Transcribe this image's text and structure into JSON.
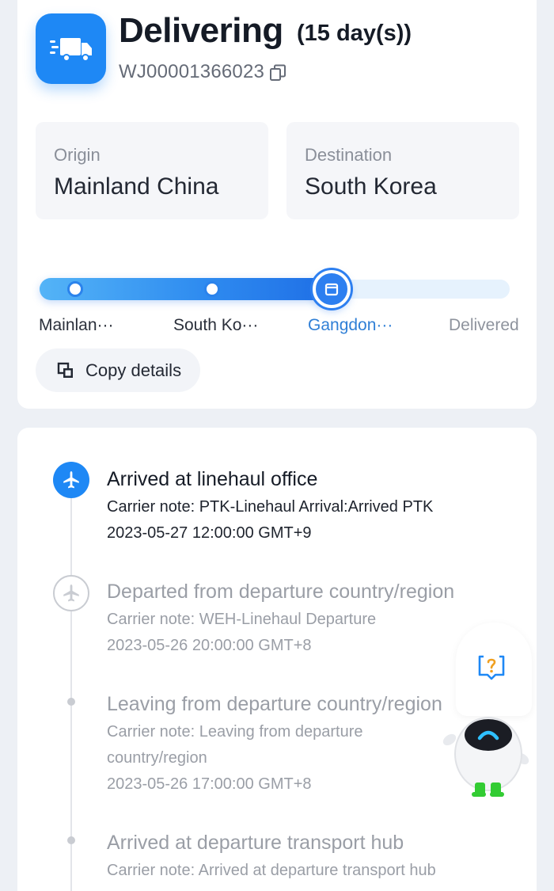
{
  "header": {
    "status": "Delivering",
    "duration": "(15 day(s))",
    "tracking_number": "WJ00001366023",
    "status_icon": "truck-icon",
    "copy_icon": "copy-icon"
  },
  "route": {
    "origin_label": "Origin",
    "origin_value": "Mainland China",
    "destination_label": "Destination",
    "destination_value": "South Korea"
  },
  "progress": {
    "fraction": 0.62,
    "steps": [
      {
        "label": "Mainlan···",
        "state": "done"
      },
      {
        "label": "South Ko···",
        "state": "done"
      },
      {
        "label": "Gangdon···",
        "state": "current"
      },
      {
        "label": "Delivered",
        "state": "pending"
      }
    ]
  },
  "actions": {
    "copy_details_label": "Copy details"
  },
  "events": [
    {
      "title": "Arrived at linehaul office",
      "note": "Carrier note: PTK-Linehaul Arrival:Arrived PTK",
      "time": "2023-05-27 12:00:00 GMT+9",
      "icon": "airplane-icon",
      "state": "active"
    },
    {
      "title": "Departed from departure country/region",
      "note": "Carrier note: WEH-Linehaul Departure",
      "time": "2023-05-26 20:00:00 GMT+8",
      "icon": "airplane-icon",
      "state": "past"
    },
    {
      "title": "Leaving from departure country/region",
      "note_line1": "Carrier note: Leaving from departure",
      "note_line2": "country/region",
      "time": "2023-05-26 17:00:00 GMT+8",
      "state": "past"
    },
    {
      "title": "Arrived at departure transport hub",
      "note": "Carrier note: Arrived at departure transport hub",
      "state": "past"
    }
  ],
  "assistant": {
    "help_icon": "help-question-icon",
    "mascot": "robot-assistant-icon"
  },
  "colors": {
    "accent": "#1e88f5",
    "page_background": "#edf0f5",
    "current_step_text": "#2f7fd6",
    "muted_text": "#9a9ea6"
  }
}
